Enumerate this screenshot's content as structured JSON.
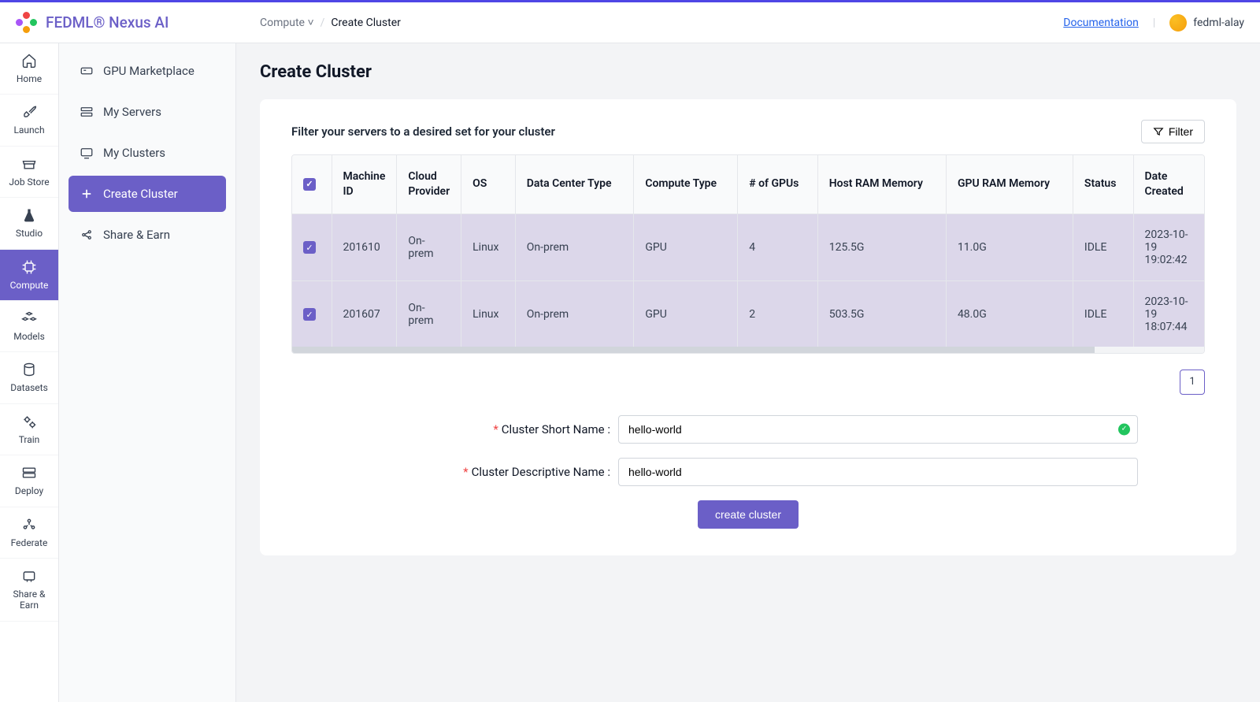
{
  "brand": "FEDML® Nexus AI",
  "breadcrumb": {
    "root": "Compute",
    "sep": "/",
    "current": "Create Cluster"
  },
  "header": {
    "documentation": "Documentation",
    "user": "fedml-alay"
  },
  "rail": [
    {
      "label": "Home"
    },
    {
      "label": "Launch"
    },
    {
      "label": "Job Store"
    },
    {
      "label": "Studio"
    },
    {
      "label": "Compute",
      "active": true
    },
    {
      "label": "Models"
    },
    {
      "label": "Datasets"
    },
    {
      "label": "Train"
    },
    {
      "label": "Deploy"
    },
    {
      "label": "Federate"
    },
    {
      "label": "Share & Earn"
    }
  ],
  "sidebar": [
    {
      "label": "GPU Marketplace"
    },
    {
      "label": "My Servers"
    },
    {
      "label": "My Clusters"
    },
    {
      "label": "Create Cluster",
      "active": true
    },
    {
      "label": "Share & Earn"
    }
  ],
  "page": {
    "title": "Create Cluster",
    "filter_title": "Filter your servers to a desired set for your cluster",
    "filter_btn": "Filter"
  },
  "table": {
    "columns": [
      "Machine ID",
      "Cloud Provider",
      "OS",
      "Data Center Type",
      "Compute Type",
      "# of GPUs",
      "Host RAM Memory",
      "GPU RAM Memory",
      "Status",
      "Date Created"
    ],
    "rows": [
      {
        "selected": true,
        "cells": [
          "201610",
          "On-prem",
          "Linux",
          "On-prem",
          "GPU",
          "4",
          "125.5G",
          "11.0G",
          "IDLE",
          "2023-10-19 19:02:42"
        ]
      },
      {
        "selected": true,
        "cells": [
          "201607",
          "On-prem",
          "Linux",
          "On-prem",
          "GPU",
          "2",
          "503.5G",
          "48.0G",
          "IDLE",
          "2023-10-19 18:07:44"
        ]
      }
    ]
  },
  "pagination": {
    "current": "1"
  },
  "form": {
    "short_label": "Cluster Short Name :",
    "short_value": "hello-world",
    "desc_label": "Cluster Descriptive Name :",
    "desc_value": "hello-world",
    "submit": "create cluster"
  }
}
